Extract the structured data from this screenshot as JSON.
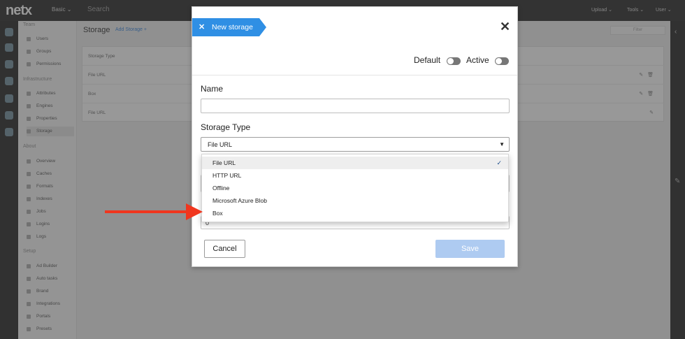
{
  "topbar": {
    "logo": "netx",
    "mode": "Basic ⌄",
    "search_placeholder": "Search",
    "upload": "Upload ⌄",
    "tools": "Tools ⌄",
    "user": "User ⌄"
  },
  "nav": {
    "sections": [
      {
        "title": "Team",
        "items": [
          "Users",
          "Groups",
          "Permissions"
        ]
      },
      {
        "title": "Infrastructure",
        "items": [
          "Attributes",
          "Engines",
          "Properties",
          "Storage"
        ]
      },
      {
        "title": "About",
        "items": [
          "Overview",
          "Caches",
          "Formats",
          "Indexes",
          "Jobs",
          "Logins",
          "Logs"
        ]
      },
      {
        "title": "Setup",
        "items": [
          "Ad Builder",
          "Auto tasks",
          "Brand",
          "Integrations",
          "Portals",
          "Presets"
        ]
      }
    ]
  },
  "main": {
    "title": "Storage",
    "add_label": "Add Storage  +",
    "filter": "Filter",
    "table_header": "Storage Type",
    "rows": [
      "File URL",
      "Box",
      "File URL"
    ]
  },
  "modal": {
    "tag_label": "New storage",
    "tag_close": "✕",
    "close": "✕",
    "default_label": "Default",
    "active_label": "Active",
    "name_label": "Name",
    "name_value": "",
    "storage_type_label": "Storage Type",
    "storage_type_value": "File URL",
    "hidden_field_value": "0",
    "options": [
      "File URL",
      "HTTP URL",
      "Offline",
      "Microsoft Azure Blob",
      "Box"
    ],
    "selected_option": "File URL",
    "cancel": "Cancel",
    "save": "Save"
  },
  "colors": {
    "accent": "#2f8fe4",
    "save_disabled": "#aecbf1",
    "arrow": "#f0361e"
  }
}
